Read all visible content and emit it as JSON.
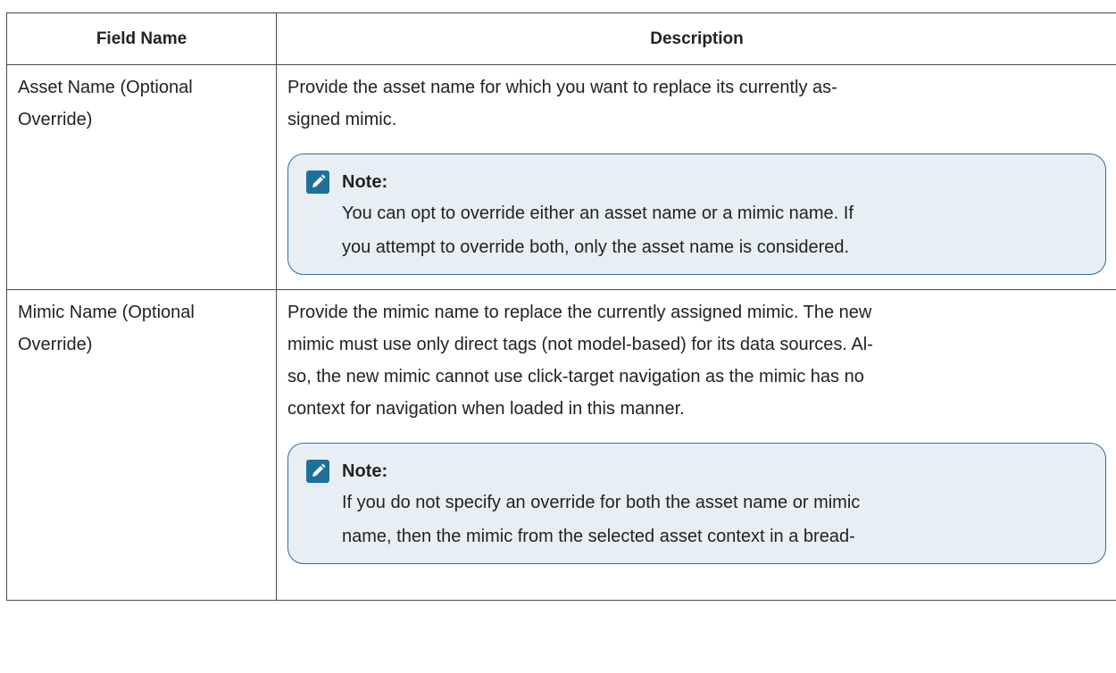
{
  "table": {
    "headers": {
      "field_name": "Field Name",
      "description": "Description"
    },
    "rows": [
      {
        "field_line1": "Asset Name (Optional",
        "field_line2": "Override)",
        "description_line1": "Provide the asset name for which you want to replace its currently as-",
        "description_line2": "signed mimic.",
        "note": {
          "icon": "pencil-note-icon",
          "label": "Note:",
          "line1": "You can opt to override either an asset name or a mimic name. If",
          "line2": "you attempt to override both, only the asset name is considered."
        }
      },
      {
        "field_line1": "Mimic Name (Optional",
        "field_line2": "Override)",
        "description_line1": "Provide the mimic name to replace the currently assigned mimic. The new",
        "description_line2": "mimic must use only direct tags (not model-based) for its data sources. Al-",
        "description_line3": "so, the new mimic cannot use click-target navigation as the mimic has no",
        "description_line4": "context for navigation when loaded in this manner.",
        "note": {
          "icon": "pencil-note-icon",
          "label": "Note:",
          "line1": "If you do not specify an override for both the asset name or mimic",
          "line2": "name, then the mimic from the selected asset context in a bread-"
        }
      }
    ]
  },
  "colors": {
    "note_background": "#e7eff5",
    "note_border": "#2f6f9b",
    "note_icon": "#1f6f9c",
    "table_border": "#4a4a4a"
  }
}
